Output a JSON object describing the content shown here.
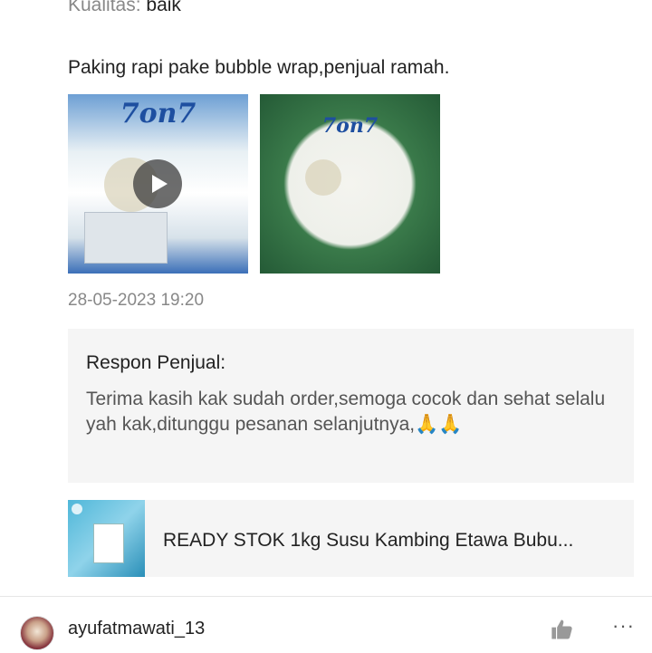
{
  "review": {
    "quality_label": "Kualitas:",
    "quality_value": "baik",
    "text": "Paking rapi pake bubble wrap,penjual ramah.",
    "media": [
      {
        "type": "video",
        "brand_text": "7on7"
      },
      {
        "type": "image",
        "brand_text": "7on7"
      }
    ],
    "timestamp": "28-05-2023 19:20"
  },
  "seller_response": {
    "title": "Respon Penjual:",
    "body": "Terima kasih kak sudah order,semoga cocok dan sehat selalu yah kak,ditunggu pesanan selanjutnya,🙏🙏"
  },
  "product": {
    "name": "READY STOK 1kg Susu Kambing Etawa Bubu..."
  },
  "next_review": {
    "username": "ayufatmawati_13",
    "like_icon": "thumbs-up-icon",
    "more_icon": "more-dots-icon",
    "more_glyph": "···"
  },
  "colors": {
    "secondary_text": "#888888",
    "response_bg": "#f5f5f5",
    "icon_gray": "#888888"
  }
}
